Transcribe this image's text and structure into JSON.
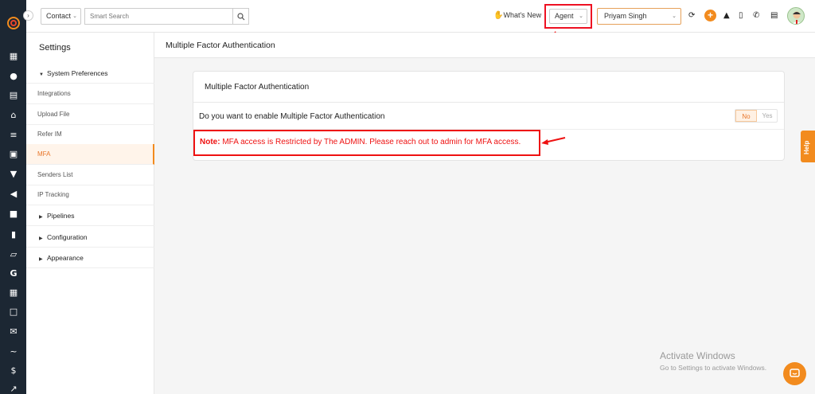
{
  "rail": {
    "icons": [
      "dashboard-icon",
      "contacts-icon",
      "documents-icon",
      "bank-icon",
      "list-icon",
      "profile-icon",
      "filter-icon",
      "megaphone-icon",
      "notes-icon",
      "analytics-icon",
      "folder-icon",
      "google-icon",
      "calendar-icon",
      "mail-icon",
      "signature-icon",
      "dollar-icon",
      "chart-icon"
    ]
  },
  "topbar": {
    "contact_label": "Contact",
    "search_placeholder": "Smart Search",
    "whats_new": "What's New",
    "agent_label": "Agent",
    "user_label": "Priyam Singh"
  },
  "settings": {
    "title": "Settings",
    "items": [
      {
        "label": "System Preferences",
        "type": "section",
        "expanded": true
      },
      {
        "label": "Integrations",
        "type": "sub"
      },
      {
        "label": "Upload File",
        "type": "sub"
      },
      {
        "label": "Refer IM",
        "type": "sub"
      },
      {
        "label": "MFA",
        "type": "sub",
        "active": true
      },
      {
        "label": "Senders List",
        "type": "sub"
      },
      {
        "label": "IP Tracking",
        "type": "sub"
      },
      {
        "label": "Pipelines",
        "type": "section"
      },
      {
        "label": "Configuration",
        "type": "section"
      },
      {
        "label": "Appearance",
        "type": "section"
      }
    ]
  },
  "main": {
    "header": "Multiple Factor Authentication",
    "card_title": "Multiple Factor Authentication",
    "question": "Do you want to enable Multiple Factor Authentication",
    "toggle_no": "No",
    "toggle_yes": "Yes",
    "note_label": "Note:",
    "note_text": " MFA access is Restricted by The ADMIN. Please reach out to admin for MFA access."
  },
  "help_label": "Help",
  "watermark": {
    "line1": "Activate Windows",
    "line2": "Go to Settings to activate Windows."
  },
  "colors": {
    "accent": "#f28b1e",
    "rail": "#1c2733",
    "annotation_red": "#e11111"
  }
}
